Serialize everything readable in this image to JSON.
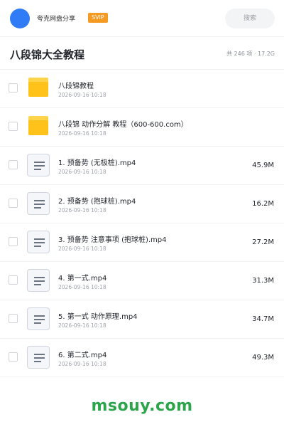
{
  "header": {
    "user_name": "夸克网盘分享",
    "badge": "SVIP",
    "search_label": "搜索",
    "accent_color": "#2f7cf6",
    "badge_color": "#f59a23"
  },
  "folder": {
    "title": "八段锦大全教程",
    "summary": "共 246 项 · 17.2G"
  },
  "items": [
    {
      "type": "folder",
      "icon": "folder-icon",
      "name": "八段锦教程",
      "date": "2026-09-16 10:18",
      "size": ""
    },
    {
      "type": "folder",
      "icon": "folder-icon",
      "name": "八段锦 动作分解 教程（600-600.com）",
      "date": "2026-09-16 10:18",
      "size": ""
    },
    {
      "type": "file",
      "icon": "file-icon",
      "name": "1. 预备势 (无极桩).mp4",
      "date": "2026-09-16 10:18",
      "size": "45.9M"
    },
    {
      "type": "file",
      "icon": "file-icon",
      "name": "2. 预备势 (抱球桩).mp4",
      "date": "2026-09-16 10:18",
      "size": "16.2M"
    },
    {
      "type": "file",
      "icon": "file-icon",
      "name": "3. 预备势 注意事项 (抱球桩).mp4",
      "date": "2026-09-16 10:18",
      "size": "27.2M"
    },
    {
      "type": "file",
      "icon": "file-icon",
      "name": "4. 第一式.mp4",
      "date": "2026-09-16 10:18",
      "size": "31.3M"
    },
    {
      "type": "file",
      "icon": "file-icon",
      "name": "5. 第一式 动作原理.mp4",
      "date": "2026-09-16 10:18",
      "size": "34.7M"
    },
    {
      "type": "file",
      "icon": "file-icon",
      "name": "6. 第二式.mp4",
      "date": "2026-09-16 10:18",
      "size": "49.3M"
    }
  ],
  "watermark": "msouy.com"
}
